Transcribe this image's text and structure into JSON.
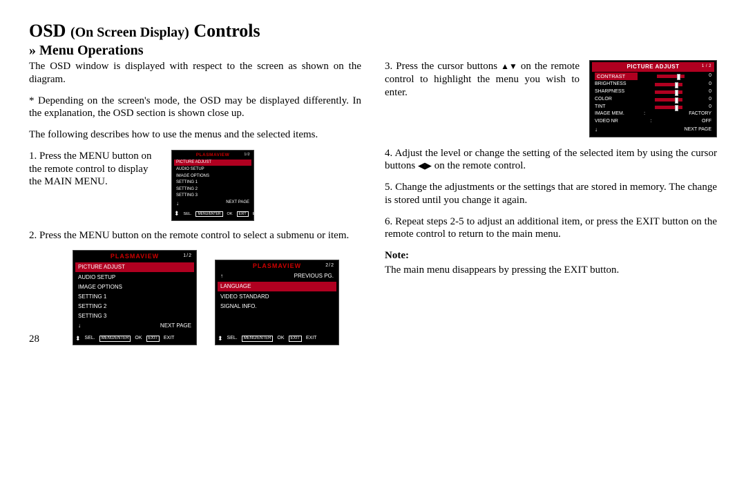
{
  "heading": {
    "main": "OSD",
    "paren": "(On Screen Display)",
    "tail": "Controls",
    "sub": "» Menu Operations"
  },
  "left": {
    "intro": "The OSD window is displayed with respect to the screen as shown on the diagram.",
    "star": "* Depending on the screen's mode, the OSD may be displayed differently. In the explanation, the OSD section is shown close up.",
    "following": "The following describes how to use the menus and the selected items.",
    "step1": "1. Press the MENU button on the remote control to display the MAIN MENU.",
    "step2": "2. Press the MENU button on the remote control to select a submenu or item."
  },
  "right": {
    "step3_a": "3. Press the cursor buttons ",
    "step3_b": " on the remote control to highlight the menu you wish to enter.",
    "step4_a": "4. Adjust the level or change the setting of the selected item by using the cursor buttons ",
    "step4_b": " on the remote control.",
    "step5": "5. Change the adjustments or the settings that are stored in memory. The change is stored until you change it again.",
    "step6": "6. Repeat steps 2-5 to adjust an additional item, or press the EXIT button on the remote control to return to the main menu.",
    "note_label": "Note:",
    "note_text": "The main menu disappears by pressing the EXIT button."
  },
  "osd_small": {
    "title": "PLASMAVIEW",
    "page": "1/2",
    "items": [
      "PICTURE ADJUST",
      "AUDIO SETUP",
      "IMAGE OPTIONS",
      "SETTING 1",
      "SETTING 2",
      "SETTING 3",
      "NEXT PAGE"
    ],
    "hint_sel": "SEL.",
    "hint_ok": "MENU/ENTER",
    "hint_ok2": "OK",
    "hint_exit": "EXIT",
    "hint_exit2": "EXIT"
  },
  "osd_large1": {
    "title": "PLASMAVIEW",
    "page": "1/2",
    "items": [
      "PICTURE ADJUST",
      "AUDIO SETUP",
      "IMAGE OPTIONS",
      "SETTING 1",
      "SETTING 2",
      "SETTING 3",
      "NEXT PAGE"
    ],
    "hint_sel": "SEL.",
    "hint_ok": "MENU/ENTER",
    "hint_ok2": "OK",
    "hint_exit": "EXIT",
    "hint_exit2": "EXIT"
  },
  "osd_large2": {
    "title": "PLASMAVIEW",
    "page": "2/2",
    "prev": "PREVIOUS PG.",
    "items": [
      "LANGUAGE",
      "VIDEO STANDARD",
      "SIGNAL INFO."
    ],
    "hint_sel": "SEL.",
    "hint_ok": "MENU/ENTER",
    "hint_ok2": "OK",
    "hint_exit": "EXIT",
    "hint_exit2": "EXIT"
  },
  "osd_pic": {
    "title": "PICTURE ADJUST",
    "page": "1 / 2",
    "rows": [
      {
        "label": "CONTRAST",
        "val": "0",
        "bar": true,
        "sel": true
      },
      {
        "label": "BRIGHTNESS",
        "val": "0",
        "bar": true
      },
      {
        "label": "SHARPNESS",
        "val": "0",
        "bar": true
      },
      {
        "label": "COLOR",
        "val": "0",
        "bar": true
      },
      {
        "label": "TINT",
        "val": "0",
        "bar": true
      },
      {
        "label": "IMAGE MEM.",
        "sep": ":",
        "val2": "FACTORY"
      },
      {
        "label": "VIDEO NR",
        "sep": ":",
        "val2": "OFF"
      }
    ],
    "next": "NEXT PAGE"
  },
  "pagenum": "28"
}
